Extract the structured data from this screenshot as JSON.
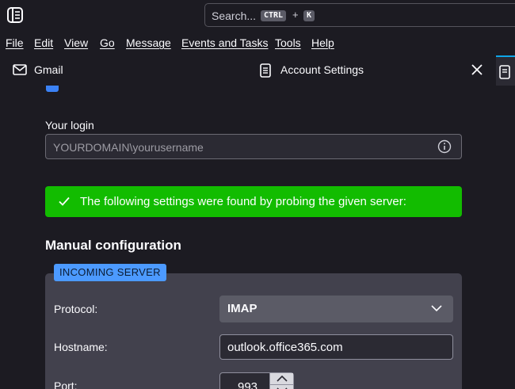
{
  "search": {
    "placeholder": "Search...",
    "key1": "CTRL",
    "plus": "+",
    "key2": "K"
  },
  "menu": [
    "File",
    "Edit",
    "View",
    "Go",
    "Message",
    "Events and Tasks",
    "Tools",
    "Help"
  ],
  "tabs": {
    "gmail": "Gmail",
    "account_settings": "Account Settings"
  },
  "form": {
    "login_label": "Your login",
    "login_placeholder": "YOURDOMAIN\\yourusername",
    "success_message": "The following settings were found by probing the given server:",
    "manual_heading": "Manual configuration",
    "incoming_badge": "INCOMING SERVER",
    "protocol_label": "Protocol:",
    "protocol_value": "IMAP",
    "hostname_label": "Hostname:",
    "hostname_value": "outlook.office365.com",
    "port_label": "Port:",
    "port_value": "993"
  },
  "colors": {
    "accent": "#0ea5e9",
    "success": "#12bc00",
    "badge": "#4c9aff",
    "background": "#1c1b22"
  },
  "icons": [
    "app-menu-icon",
    "mail-icon",
    "settings-page-icon",
    "close-icon",
    "info-icon",
    "checkmark-icon",
    "chevron-down-icon",
    "spin-up-icon",
    "spin-down-icon"
  ]
}
